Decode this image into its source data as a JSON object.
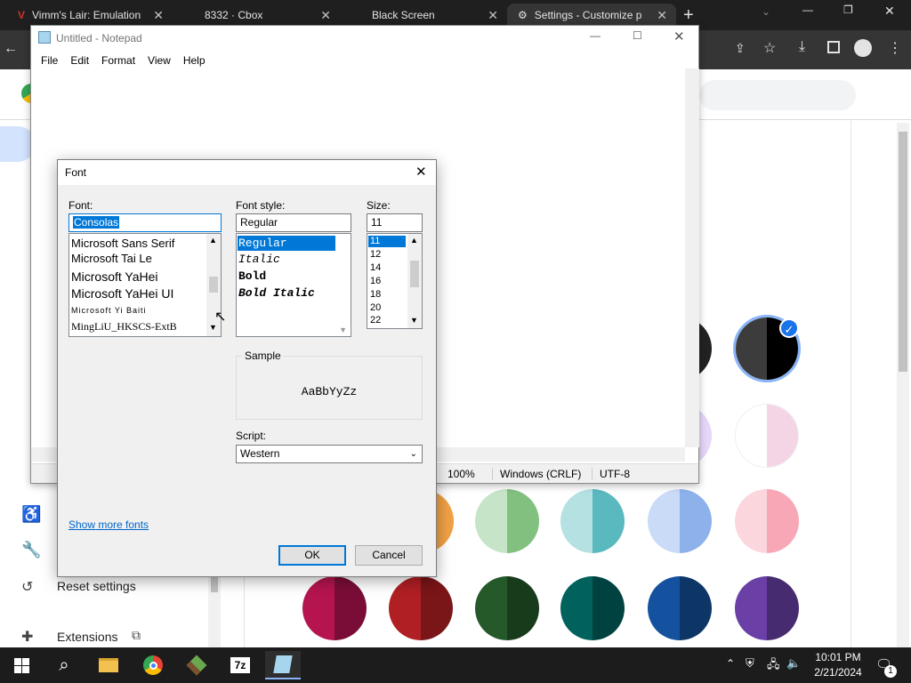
{
  "browser": {
    "tabs": [
      {
        "title": "Vimm's Lair: Emulation"
      },
      {
        "title": "8332 · Cbox"
      },
      {
        "title": "Black Screen"
      },
      {
        "title": "Settings - Customize p"
      }
    ],
    "new_tab": "+"
  },
  "settings": {
    "reset_label": "Reset settings",
    "extensions_label": "Extensions"
  },
  "notepad": {
    "title": "Untitled - Notepad",
    "menu": [
      "File",
      "Edit",
      "Format",
      "View",
      "Help"
    ],
    "status": {
      "zoom": "100%",
      "line_ending": "Windows (CRLF)",
      "encoding": "UTF-8"
    }
  },
  "font_dialog": {
    "title": "Font",
    "font_label": "Font:",
    "font_value": "Consolas",
    "fonts": [
      "Microsoft Sans Serif",
      "Microsoft Tai Le",
      "Microsoft YaHei",
      "Microsoft YaHei UI",
      "Microsoft Yi Baiti",
      "MingLiU_HKSCS-ExtB"
    ],
    "style_label": "Font style:",
    "style_value": "Regular",
    "styles": [
      "Regular",
      "Italic",
      "Bold",
      "Bold Italic"
    ],
    "size_label": "Size:",
    "size_value": "11",
    "sizes": [
      "11",
      "12",
      "14",
      "16",
      "18",
      "20",
      "22"
    ],
    "sample_label": "Sample",
    "sample_text": "AaBbYyZz",
    "script_label": "Script:",
    "script_value": "Western",
    "show_more": "Show more fonts",
    "ok": "OK",
    "cancel": "Cancel"
  },
  "taskbar": {
    "time": "10:01 PM",
    "date": "2/21/2024",
    "notification_count": "1",
    "icons": [
      "windows-start",
      "search",
      "file-explorer",
      "chrome",
      "minecraft",
      "7zip",
      "notepad"
    ]
  },
  "colors": {
    "accent": "#0078d7",
    "chrome_dark": "#1f1f1f",
    "taskbar": "#1c1c1c"
  }
}
